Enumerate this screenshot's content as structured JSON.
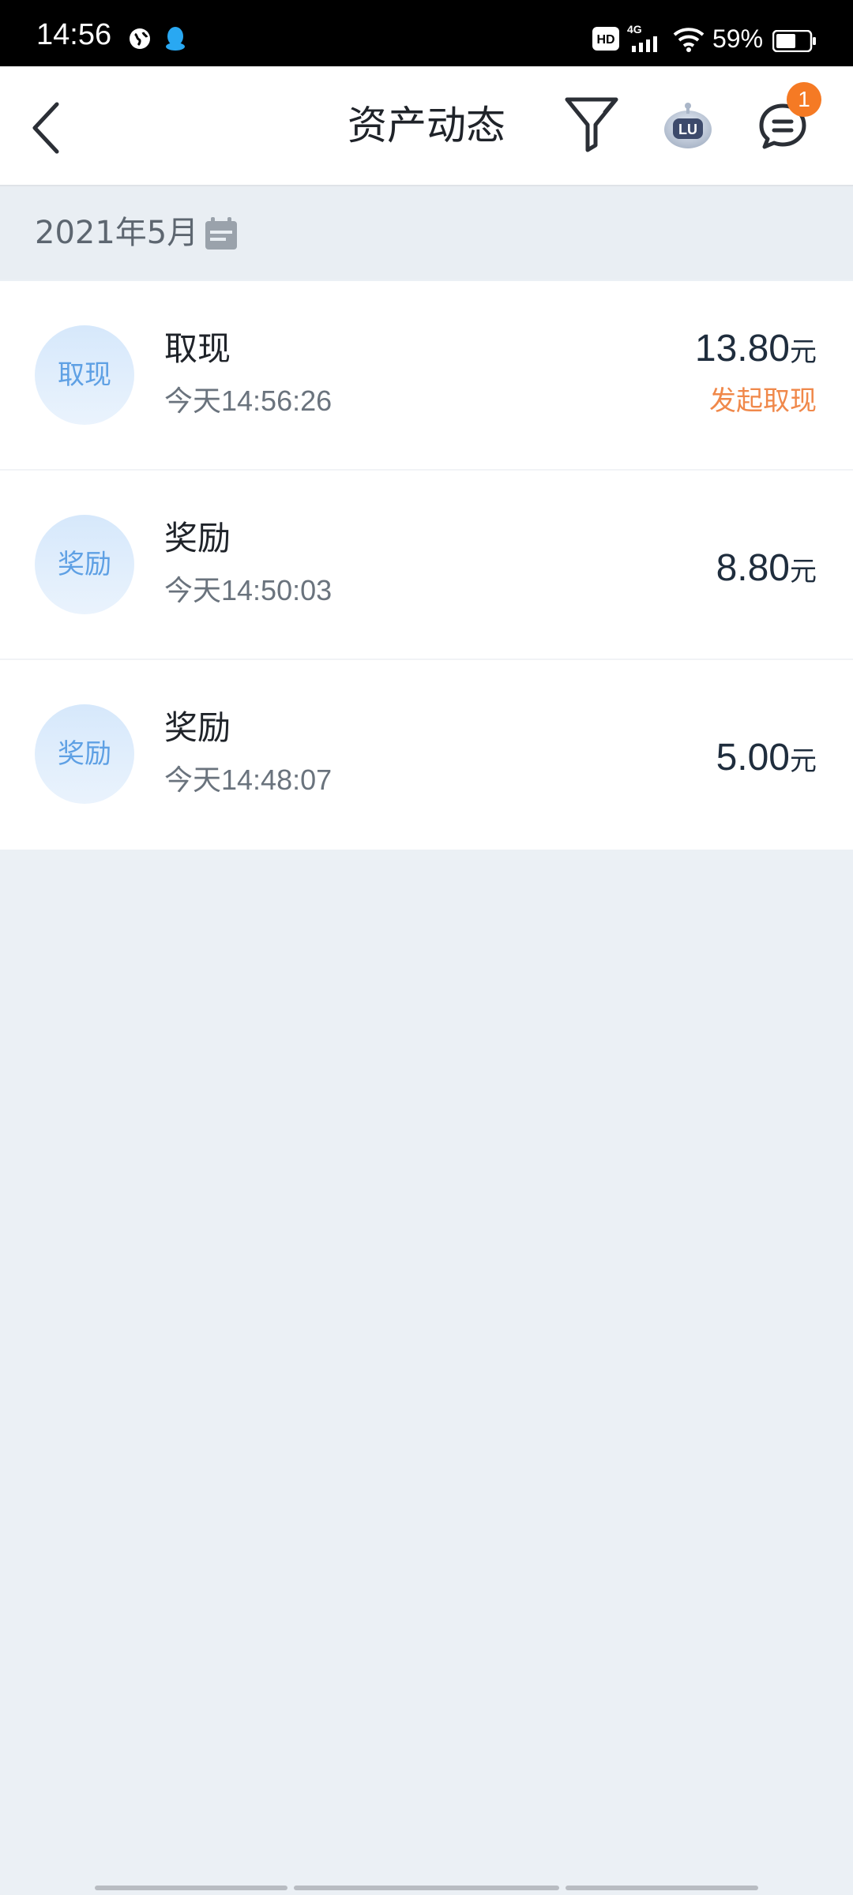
{
  "status_bar": {
    "time": "14:56",
    "network": "4G",
    "hd_label": "HD",
    "battery": "59%",
    "battery_level": 0.59
  },
  "header": {
    "title": "资产动态",
    "badge_count": "1",
    "robot_label": "LU"
  },
  "month_bar": {
    "label": "2021年5月"
  },
  "items": [
    {
      "avatar": "取现",
      "title": "取现",
      "time": "今天14:56:26",
      "amount": "13.80",
      "unit": "元",
      "status": "发起取现"
    },
    {
      "avatar": "奖励",
      "title": "奖励",
      "time": "今天14:50:03",
      "amount": "8.80",
      "unit": "元"
    },
    {
      "avatar": "奖励",
      "title": "奖励",
      "time": "今天14:48:07",
      "amount": "5.00",
      "unit": "元"
    }
  ],
  "colors": {
    "accent_orange": "#f57a24",
    "avatar_text": "#5ea0e4",
    "status_text": "#f0884a",
    "page_background": "#ebf0f5"
  },
  "icons": {
    "back": "chevron-left-icon",
    "filter": "filter-icon",
    "robot": "robot-assistant-icon",
    "message": "message-icon",
    "calendar": "calendar-icon"
  }
}
